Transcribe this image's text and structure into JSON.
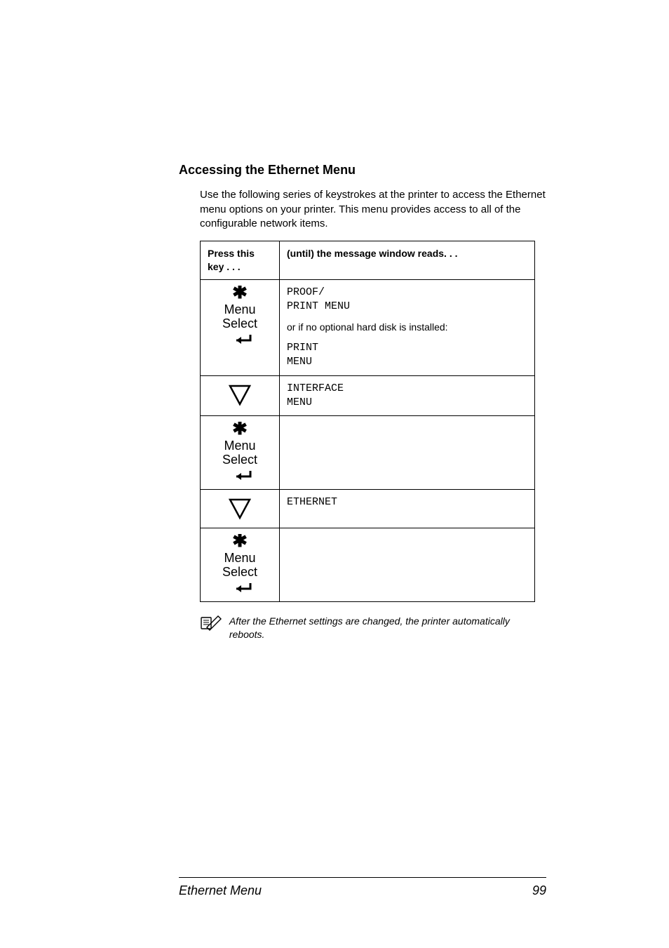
{
  "section_title": "Accessing the Ethernet Menu",
  "intro": "Use the following series of keystrokes at the printer to access the Ethernet menu options on your printer. This menu provides access to all of the configurable network items.",
  "table": {
    "headers": [
      "Press this key . . .",
      "(until) the message window reads. . ."
    ],
    "rows": [
      {
        "key_icon": "menu-select",
        "line1a": "PROOF/",
        "line1b": "PRINT MENU",
        "between": "or if no optional hard disk is installed:",
        "line2a": "PRINT",
        "line2b": "MENU"
      },
      {
        "key_icon": "down",
        "line1a": "INTERFACE",
        "line1b": "MENU"
      },
      {
        "key_icon": "menu-select",
        "empty": true
      },
      {
        "key_icon": "down",
        "line1a": "ETHERNET"
      },
      {
        "key_icon": "menu-select",
        "empty": true
      }
    ]
  },
  "note": "After the Ethernet settings are changed, the printer automatically reboots.",
  "footer_title": "Ethernet Menu",
  "footer_page": "99"
}
